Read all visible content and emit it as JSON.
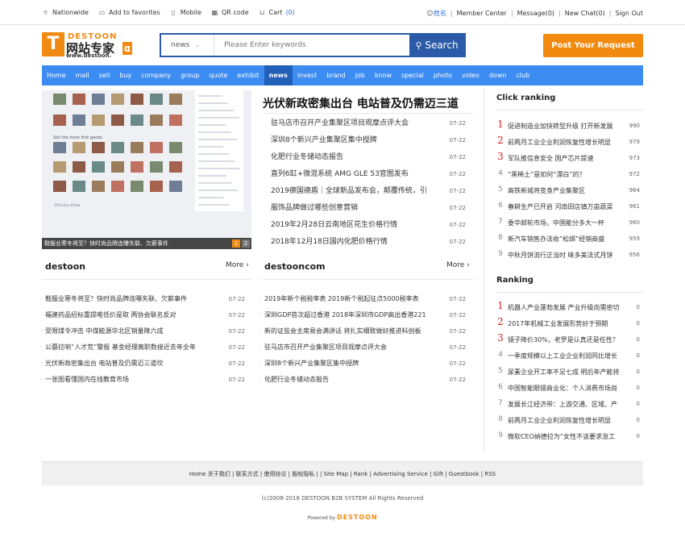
{
  "topbar": {
    "left": [
      {
        "icon": "location-icon",
        "label": "Nationwide"
      },
      {
        "icon": "favorite-icon",
        "label": "Add to favorites"
      },
      {
        "icon": "mobile-icon",
        "label": "Mobile"
      },
      {
        "icon": "qr-icon",
        "label": "QR code"
      },
      {
        "icon": "cart-icon",
        "label": "Cart",
        "count": "(0)"
      }
    ],
    "right": {
      "user": "姓名",
      "links": [
        "Member Center",
        "Message(0)",
        "New Chat(0)",
        "Sign Out"
      ]
    }
  },
  "logo": {
    "cn": "网站专家",
    "en": "DESTOON",
    "url": "www.destoon."
  },
  "search": {
    "module": "news",
    "placeholder": "Please Enter keywords",
    "button": "Search"
  },
  "post_button": "Post Your Request",
  "nav": [
    "Home",
    "mall",
    "sell",
    "buy",
    "company",
    "group",
    "quote",
    "exhibit",
    "news",
    "invest",
    "brand",
    "job",
    "know",
    "special",
    "photo",
    "video",
    "down",
    "club"
  ],
  "nav_active": "news",
  "slide": {
    "text_1": "Sell the most first goods",
    "text_2": "Picture show",
    "caption": "鞋服业寒冬将至？快时尚品牌连曝失联、欠薪事件",
    "pages": [
      "1",
      "2"
    ]
  },
  "headline": "光伏新政密集出台 电站普及仍需迈三道",
  "news": [
    {
      "title": "驻马店市召开产业集聚区项目观摩点评大会",
      "date": "07-22"
    },
    {
      "title": "深圳8个新兴产业集聚区集中授牌",
      "date": "07-22"
    },
    {
      "title": "化肥行业冬储动态报告",
      "date": "07-22"
    },
    {
      "title": "直列6缸+微混系统 AMG GLE 53官图发布",
      "date": "07-22"
    },
    {
      "title": "2019德国德盾｜全球新品发布会，颠覆传统，引",
      "date": "07-22"
    },
    {
      "title": "服饰品牌做过哪些创意营销",
      "date": "07-22"
    },
    {
      "title": "2019年2月28日云南地区花生价格行情",
      "date": "07-22"
    },
    {
      "title": "2018年12月18日国内化肥价格行情",
      "date": "07-22"
    }
  ],
  "block_destoon": {
    "title": "destoon",
    "more": "More",
    "items": [
      {
        "title": "鞋服业寒冬将至？快时尚品牌连曝失联、欠薪事件",
        "date": "07-22"
      },
      {
        "title": "福建药品招标重提唯低价是取 两协会联名反对",
        "date": "07-22"
      },
      {
        "title": "受限煤令冲击 中煤能源华北区销量降六成",
        "date": "07-22"
      },
      {
        "title": "公募拉响“人才荒”警报 基金经理离职数接近去年全年",
        "date": "07-22"
      },
      {
        "title": "光伏新政密集出台 电站普及仍需迈三道坎",
        "date": "07-22"
      },
      {
        "title": "一张图看懂国内在线教育市场",
        "date": "07-22"
      }
    ]
  },
  "block_destooncom": {
    "title": "destooncom",
    "more": "More",
    "items": [
      {
        "title": "2019年新个税税率表 2019新个税起征点5000税率表",
        "date": "07-22"
      },
      {
        "title": "深圳GDP首次超过香港 2018年深圳市GDP高出香港221",
        "date": "07-22"
      },
      {
        "title": "新的证监会主席易会满讲话 将扎实细致做好推进科创板",
        "date": "07-22"
      },
      {
        "title": "驻马店市召开产业集聚区项目观摩点评大会",
        "date": "07-22"
      },
      {
        "title": "深圳8个新兴产业集聚区集中授牌",
        "date": "07-22"
      },
      {
        "title": "化肥行业冬储动态报告",
        "date": "07-22"
      }
    ]
  },
  "click_ranking": {
    "title": "Click ranking",
    "items": [
      {
        "n": "1",
        "title": "促进制造业加快转型升级 打开新发展",
        "count": "990"
      },
      {
        "n": "2",
        "title": "前两月工业企业利润恢复性增长明显",
        "count": "979"
      },
      {
        "n": "3",
        "title": "军队推信息安全 国产芯片提速",
        "count": "973"
      },
      {
        "n": "4",
        "title": "“黑稀土”是如何“漂白”的？",
        "count": "972"
      },
      {
        "n": "5",
        "title": "高铁新城将变身产业集聚区",
        "count": "964"
      },
      {
        "n": "6",
        "title": "春耕生产已开启 河南田店镇万亩蔬菜",
        "count": "961"
      },
      {
        "n": "7",
        "title": "委华邮轮市场，中国能分多大一杯",
        "count": "960"
      },
      {
        "n": "8",
        "title": "新汽车销售办法收“松绑”经销商盛",
        "count": "959"
      },
      {
        "n": "9",
        "title": "中秋月饼流行正当时 味多美法式月饼",
        "count": "956"
      }
    ]
  },
  "ranking": {
    "title": "Ranking",
    "items": [
      {
        "n": "1",
        "title": "机器人产业蓬勃发展 产业升级尚需密切",
        "count": "0"
      },
      {
        "n": "2",
        "title": "2017年机械工业发展形势好于预期",
        "count": "0"
      },
      {
        "n": "3",
        "title": "镜子降价30%，老罗是认真还是任性？",
        "count": "0"
      },
      {
        "n": "4",
        "title": "一季度规模以上工业企业利润同比增长",
        "count": "0"
      },
      {
        "n": "5",
        "title": "尿素企业开工率不足七成 明后年产能将",
        "count": "0"
      },
      {
        "n": "6",
        "title": "中国智能眼镜商业化：个人消费市场尚",
        "count": "0"
      },
      {
        "n": "7",
        "title": "发展长江经济带：上游交通、区域、产",
        "count": "0"
      },
      {
        "n": "8",
        "title": "前两月工业企业利润恢复性增长明显",
        "count": "0"
      },
      {
        "n": "9",
        "title": "微软CEO纳德拉为“女性不该要求涨工",
        "count": "0"
      }
    ]
  },
  "footer": {
    "links": "Home 关于我们 | 联系方式 | 使用协议 | 版权隐私 | | Site Map | Rank | Advertising Service | Gift | Guestbook | RSS",
    "copyright": "(c)2008-2018 DESTOON B2B SYSTEM All Rights Reserved",
    "powered": "Powered by",
    "brand": "DESTOON"
  },
  "colors": {
    "accent": "#f08a10",
    "nav": "#3d8cf2",
    "nav_active": "#215fb9",
    "search": "#2a5aa8",
    "rank_top": "#d42020"
  }
}
